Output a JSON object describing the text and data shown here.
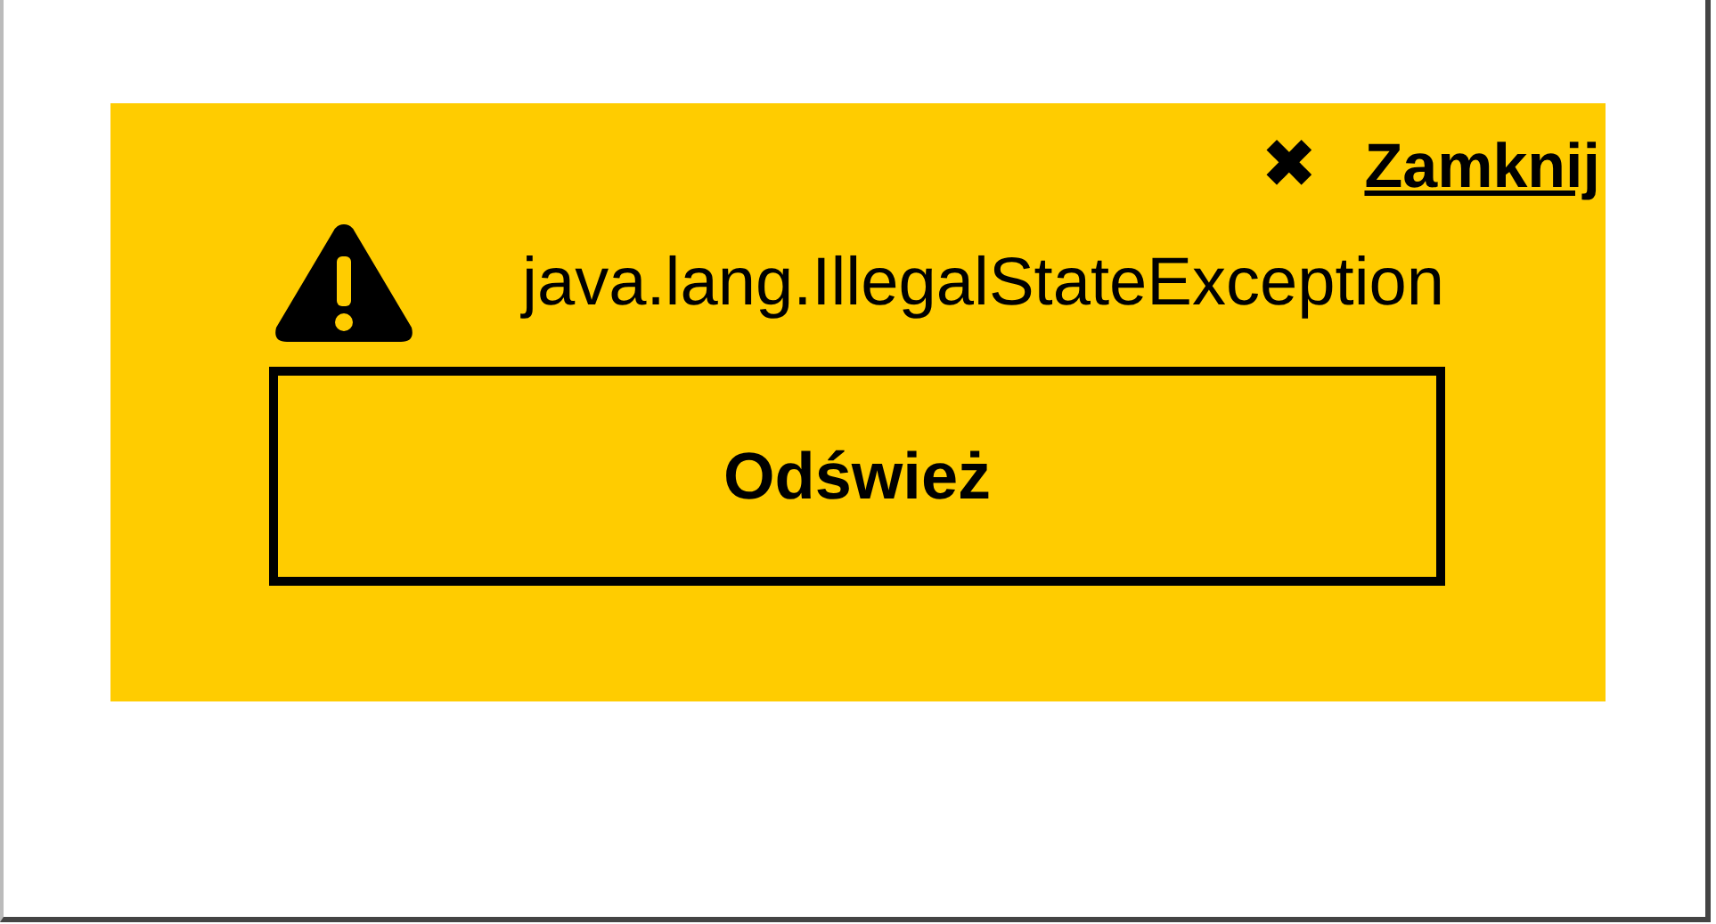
{
  "close_link": {
    "icon": "✖",
    "label": "Zamknij"
  },
  "error": {
    "message": "java.lang.IllegalStateException"
  },
  "refresh_button": {
    "label": "Odśwież"
  }
}
